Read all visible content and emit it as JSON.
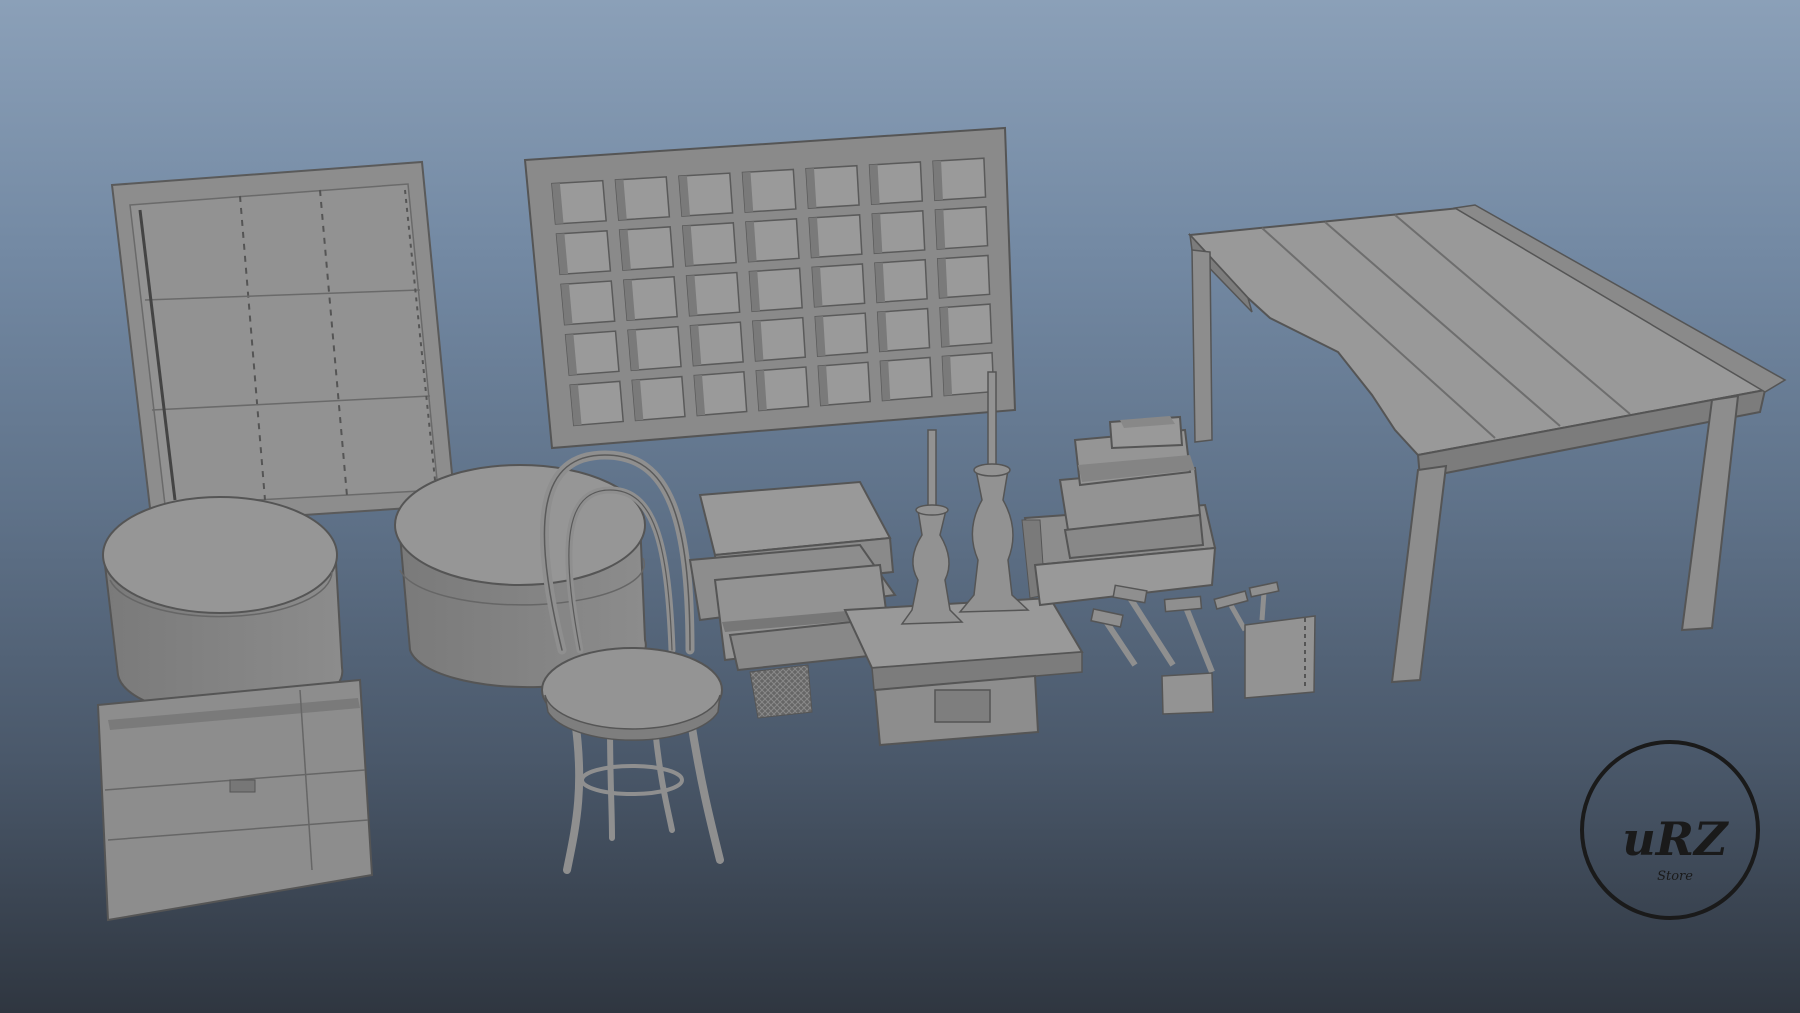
{
  "scene": {
    "background_top": "#8ba0b8",
    "background_bottom": "#2f3640",
    "model_color": "#8e8e8e",
    "objects": [
      "cabinet-doors",
      "pigeonhole-shelf",
      "wooden-table",
      "round-hatbox-left",
      "round-hatbox-center",
      "bentwood-chair",
      "stacked-trunks",
      "candlesticks",
      "small-side-table",
      "stacked-boxes",
      "hammers",
      "tool-frames",
      "floor-trunk"
    ]
  },
  "logo": {
    "main": "uRZ",
    "sub": "Store"
  }
}
